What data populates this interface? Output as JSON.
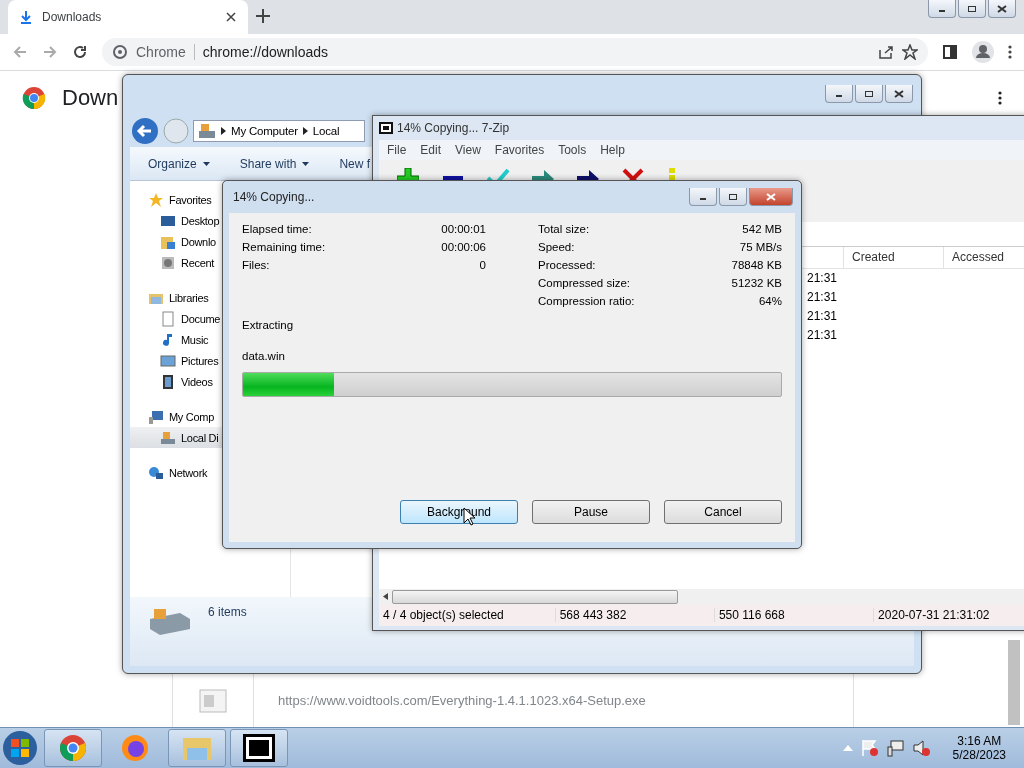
{
  "browser": {
    "tabs": [
      {
        "title": "Downloads",
        "selected": true
      }
    ],
    "address": {
      "site": "Chrome",
      "url": "chrome://downloads"
    },
    "page_heading": "Down",
    "download": {
      "url": "https://www.voidtools.com/Everything-1.4.1.1023.x64-Setup.exe"
    }
  },
  "explorer": {
    "breadcrumb": [
      "My Computer",
      "Local"
    ],
    "toolbar": [
      "Organize",
      "Share with",
      "New f"
    ],
    "nav": [
      {
        "label": "Favorites",
        "selected": false,
        "children": [
          {
            "label": "Desktop",
            "selected": false
          },
          {
            "label": "Downlo",
            "selected": false
          },
          {
            "label": "Recent",
            "selected": false
          }
        ]
      },
      {
        "label": "Libraries",
        "selected": false,
        "children": [
          {
            "label": "Docume",
            "selected": false
          },
          {
            "label": "Music",
            "selected": false
          },
          {
            "label": "Pictures",
            "selected": false
          },
          {
            "label": "Videos",
            "selected": false
          }
        ]
      },
      {
        "label": "My Comp",
        "selected": false,
        "children": [
          {
            "label": "Local Di",
            "selected": true
          }
        ]
      },
      {
        "label": "Network",
        "selected": false
      }
    ],
    "status": "6 items"
  },
  "sevenzip": {
    "title": "14% Copying... 7-Zip",
    "menu": [
      "File",
      "Edit",
      "View",
      "Favorites",
      "Tools",
      "Help"
    ],
    "columns": [
      "Created",
      "Accessed"
    ],
    "rows": [
      "21:31",
      "21:31",
      "21:31",
      "21:31"
    ],
    "status": [
      "4 / 4 object(s) selected",
      "568 443 382",
      "550 116 668",
      "2020-07-31 21:31:02"
    ]
  },
  "dialog": {
    "title": "14% Copying...",
    "left": [
      {
        "label": "Elapsed time:",
        "value": "00:00:01"
      },
      {
        "label": "Remaining time:",
        "value": "00:00:06"
      },
      {
        "label": "Files:",
        "value": "0"
      }
    ],
    "right": [
      {
        "label": "Total size:",
        "value": "542 MB"
      },
      {
        "label": "Speed:",
        "value": "75 MB/s"
      },
      {
        "label": "Processed:",
        "value": "78848 KB"
      },
      {
        "label": "Compressed size:",
        "value": "51232 KB"
      },
      {
        "label": "Compression ratio:",
        "value": "64%"
      }
    ],
    "action": "Extracting",
    "file": "data.win",
    "progress": {
      "level": 0.17
    },
    "buttons": [
      {
        "label": "Background",
        "selected": true
      },
      {
        "label": "Pause",
        "selected": false
      },
      {
        "label": "Cancel",
        "selected": false
      }
    ]
  },
  "taskbar": {
    "apps": [
      {
        "kind": "chrome",
        "running": true
      },
      {
        "kind": "firefox",
        "running": false
      },
      {
        "kind": "explorer",
        "running": true
      },
      {
        "kind": "sevenzip",
        "running": true
      }
    ],
    "time": "3:16 AM",
    "date": "5/28/2023"
  }
}
